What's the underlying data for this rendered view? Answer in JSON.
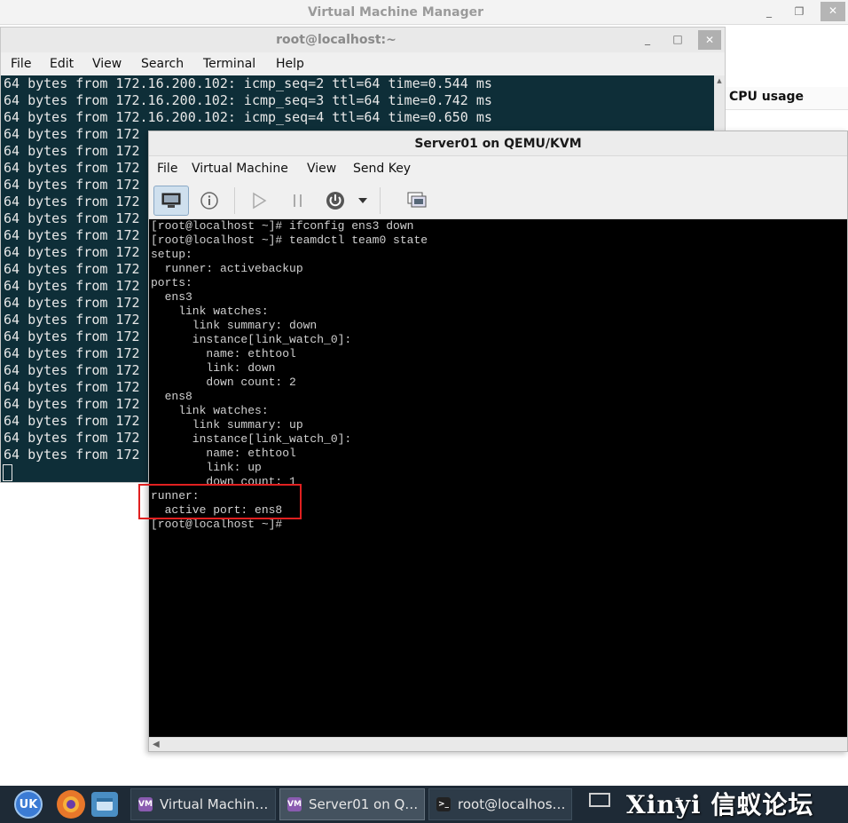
{
  "vmm": {
    "title": "Virtual Machine Manager",
    "column_cpu": "CPU usage",
    "btn_minimize": "_",
    "btn_maximize": "❐",
    "btn_close": "✕"
  },
  "terminal": {
    "title": "root@localhost:~",
    "menu": [
      "File",
      "Edit",
      "View",
      "Search",
      "Terminal",
      "Help"
    ],
    "btn_minimize": "_",
    "btn_maximize": "□",
    "btn_close": "✕",
    "lines": [
      "64 bytes from 172.16.200.102: icmp_seq=2 ttl=64 time=0.544 ms",
      "64 bytes from 172.16.200.102: icmp_seq=3 ttl=64 time=0.742 ms",
      "64 bytes from 172.16.200.102: icmp_seq=4 ttl=64 time=0.650 ms",
      "64 bytes from 172",
      "64 bytes from 172",
      "64 bytes from 172",
      "64 bytes from 172",
      "64 bytes from 172",
      "64 bytes from 172",
      "64 bytes from 172",
      "64 bytes from 172",
      "64 bytes from 172",
      "64 bytes from 172",
      "64 bytes from 172",
      "64 bytes from 172",
      "64 bytes from 172",
      "64 bytes from 172",
      "64 bytes from 172",
      "64 bytes from 172",
      "64 bytes from 172",
      "64 bytes from 172",
      "64 bytes from 172",
      "64 bytes from 172"
    ]
  },
  "server": {
    "title": "Server01 on QEMU/KVM",
    "menu": [
      "File",
      "Virtual Machine",
      "View",
      "Send Key"
    ],
    "toolbar_icons": [
      "monitor-icon",
      "info-icon",
      "play-icon",
      "pause-icon",
      "power-icon",
      "dropdown-arrow-icon",
      "screenshot-icon"
    ],
    "console_lines": [
      "[root@localhost ~]# ifconfig ens3 down",
      "[root@localhost ~]# teamdctl team0 state",
      "setup:",
      "  runner: activebackup",
      "ports:",
      "  ens3",
      "    link watches:",
      "      link summary: down",
      "      instance[link_watch_0]:",
      "        name: ethtool",
      "        link: down",
      "        down count: 2",
      "  ens8",
      "    link watches:",
      "      link summary: up",
      "      instance[link_watch_0]:",
      "        name: ethtool",
      "        link: up",
      "        down count: 1",
      "runner:",
      "  active port: ens8",
      "[root@localhost ~]#"
    ]
  },
  "taskbar": {
    "launcher_menu": "UK",
    "tasks": [
      {
        "label": "Virtual Machin…",
        "icon": "VM"
      },
      {
        "label": "Server01 on Q…",
        "icon": "VM"
      },
      {
        "label": "root@localhos…",
        "icon": ">_"
      }
    ],
    "clock": "1",
    "watermark": "Xinyi 信蚁论坛"
  }
}
